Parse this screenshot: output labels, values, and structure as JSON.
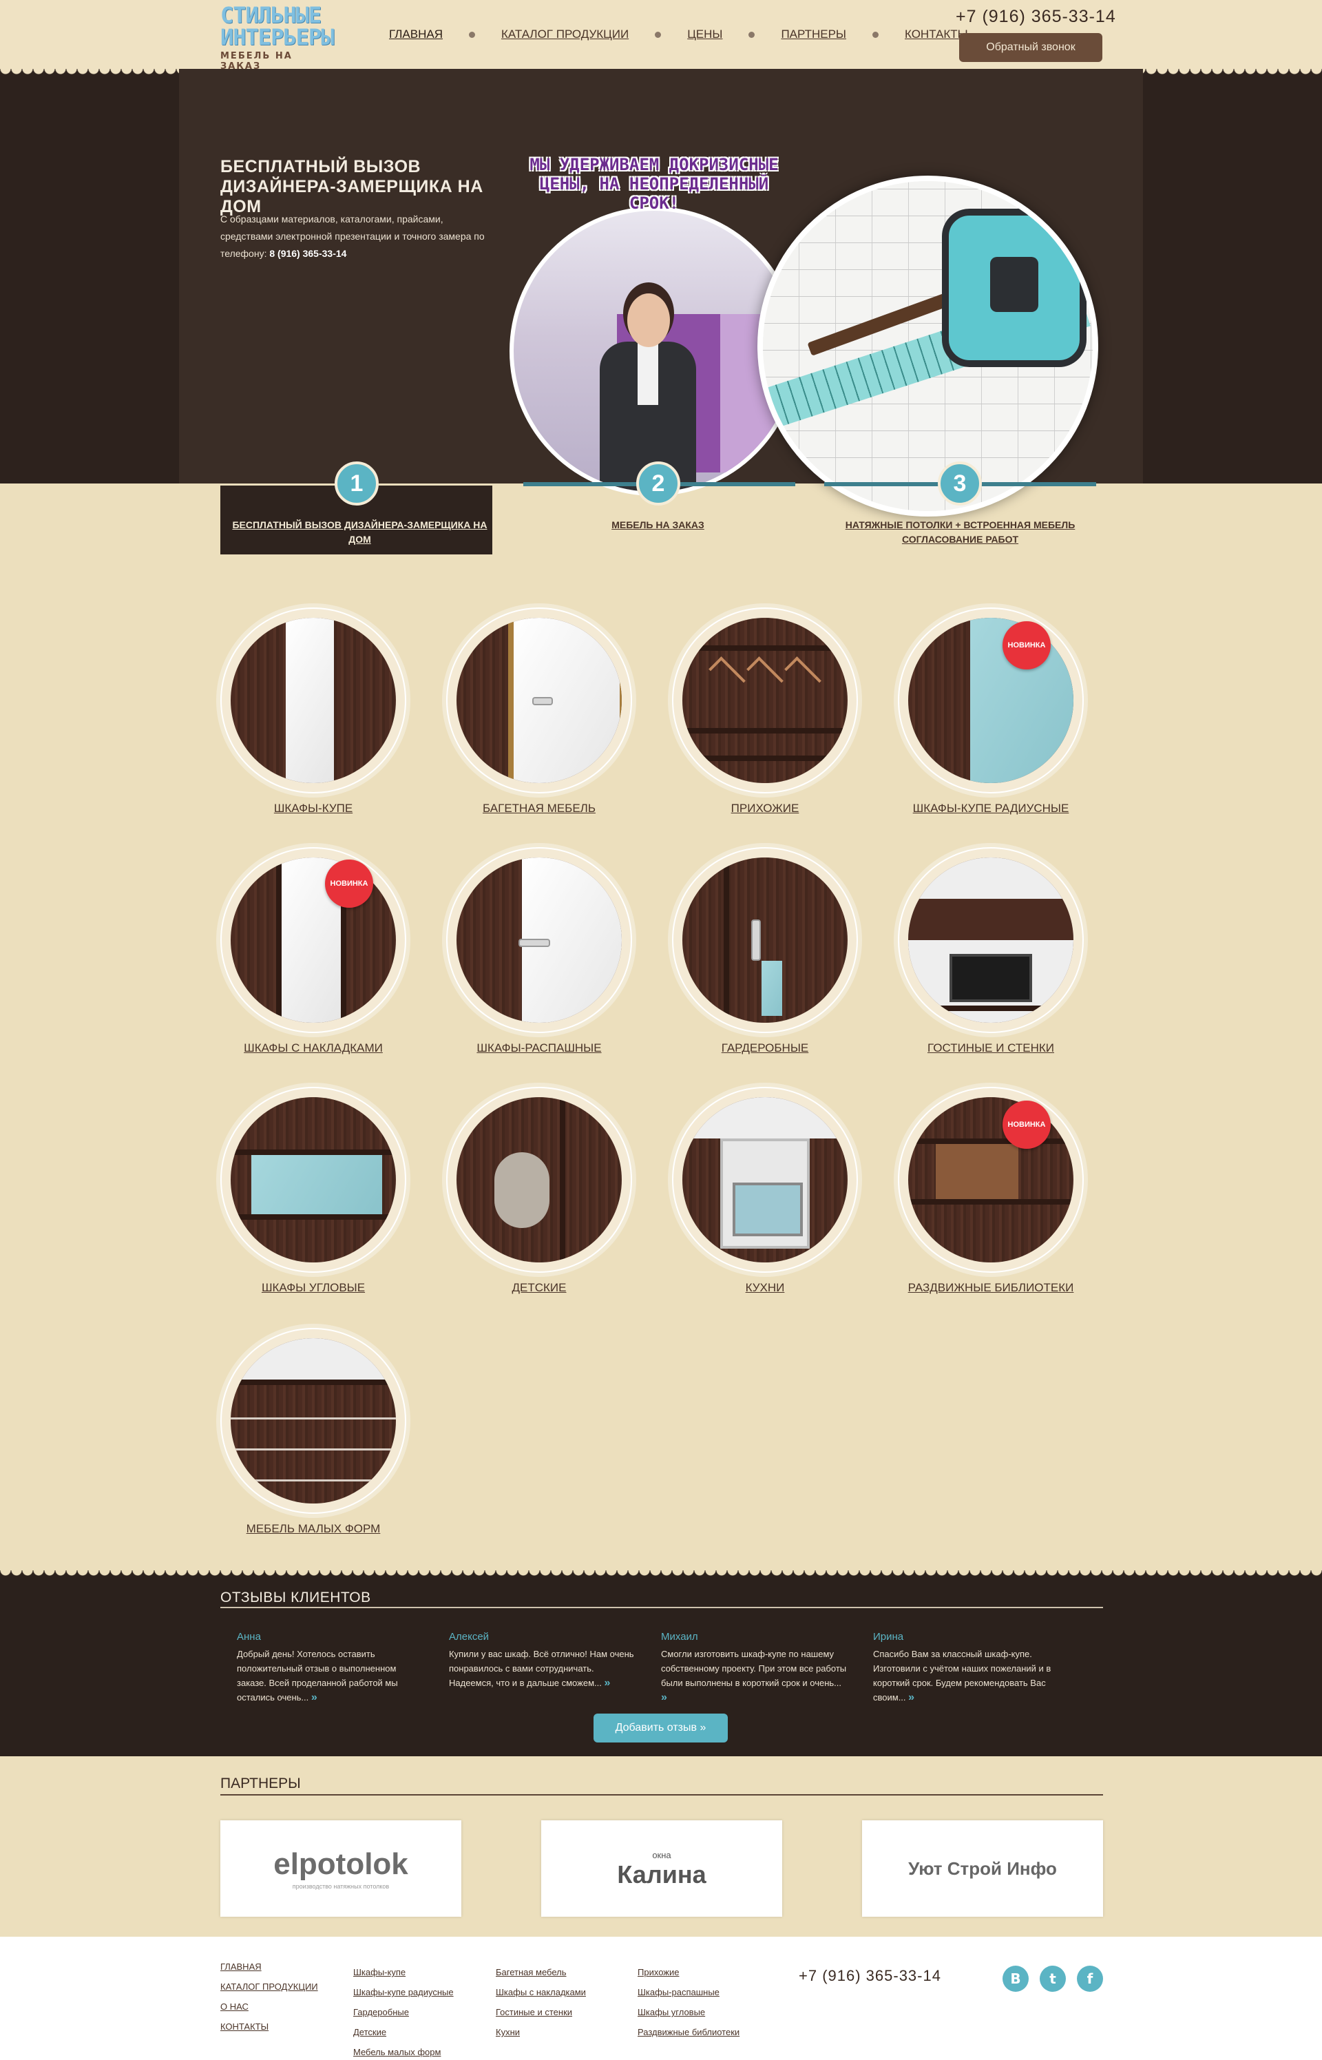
{
  "header": {
    "logo_line1": "СТИЛЬНЫЕ",
    "logo_line2": "ИНТЕРЬЕРЫ",
    "logo_line3": "МЕБЕЛЬ НА ЗАКАЗ",
    "nav": [
      "ГЛАВНАЯ",
      "КАТАЛОГ ПРОДУКЦИИ",
      "ЦЕНЫ",
      "ПАРТНЕРЫ",
      "КОНТАКТЫ"
    ],
    "phone": "+7 (916) 365-33-14",
    "callback_label": "Обратный звонок"
  },
  "hero": {
    "title": "БЕСПЛАТНЫЙ ВЫЗОВ ДИЗАЙНЕРА-ЗАМЕРЩИКА НА ДОМ",
    "text": "С образцами материалов, каталогами, прайсами, средствами электронной презентации и точного замера по телефону:",
    "text_phone": "8 (916) 365-33-14",
    "promo": "МЫ УДЕРЖИВАЕМ ДОКРИЗИСНЫЕ ЦЕНЫ, НА НЕОПРЕДЕЛЕННЫЙ СРОК!"
  },
  "steps": [
    {
      "num": "1",
      "label": "БЕСПЛАТНЫЙ ВЫЗОВ ДИЗАЙНЕРА-ЗАМЕРЩИКА НА ДОМ"
    },
    {
      "num": "2",
      "label": "МЕБЕЛЬ НА ЗАКАЗ"
    },
    {
      "num": "3",
      "label": "НАТЯЖНЫЕ ПОТОЛКИ + ВСТРОЕННАЯ МЕБЕЛЬ СОГЛАСОВАНИЕ РАБОТ"
    }
  ],
  "catalog": [
    {
      "label": "ШКАФЫ-КУПЕ"
    },
    {
      "label": "БАГЕТНАЯ МЕБЕЛЬ"
    },
    {
      "label": "ПРИХОЖИЕ"
    },
    {
      "label": "ШКАФЫ-КУПЕ РАДИУСНЫЕ",
      "badge": "НОВИНКА"
    },
    {
      "label": "ШКАФЫ С НАКЛАДКАМИ",
      "badge": "НОВИНКА"
    },
    {
      "label": "ШКАФЫ-РАСПАШНЫЕ"
    },
    {
      "label": "ГАРДЕРОБНЫЕ"
    },
    {
      "label": "ГОСТИНЫЕ И СТЕНКИ"
    },
    {
      "label": "ШКАФЫ УГЛОВЫЕ"
    },
    {
      "label": "ДЕТСКИЕ"
    },
    {
      "label": "КУХНИ"
    },
    {
      "label": "РАЗДВИЖНЫЕ БИБЛИОТЕКИ",
      "badge": "НОВИНКА"
    },
    {
      "label": "МЕБЕЛЬ МАЛЫХ ФОРМ"
    }
  ],
  "reviews": {
    "title": "ОТЗЫВЫ КЛИЕНТОВ",
    "items": [
      {
        "name": "Анна",
        "text": "Добрый день! Хотелось оставить положительный отзыв о выполненном заказе. Всей проделанной работой мы остались очень..."
      },
      {
        "name": "Алексей",
        "text": "Купили у вас шкаф. Всё отлично! Нам очень понравилось с вами сотрудничать. Надеемся, что и в дальше сможем..."
      },
      {
        "name": "Михаил",
        "text": "Смогли изготовить шкаф-купе по нашему собственному проекту. При этом все работы были выполнены в короткий срок и очень..."
      },
      {
        "name": "Ирина",
        "text": "Спасибо Вам за классный шкаф-купе. Изготовили с учётом наших пожеланий и в короткий срок. Будем рекомендовать Вас своим..."
      }
    ],
    "more_glyph": "»",
    "add_label": "Добавить отзыв »"
  },
  "partners": {
    "title": "ПАРТНЕРЫ",
    "items": [
      {
        "name": "elpotolok",
        "sub": "производство натяжных потолков"
      },
      {
        "name": "Калина",
        "sub": "окна"
      },
      {
        "name": "Уют Строй Инфо",
        "sub": ""
      }
    ]
  },
  "footer": {
    "col1": [
      "ГЛАВНАЯ",
      "КАТАЛОГ ПРОДУКЦИИ",
      "О НАС",
      "КОНТАКТЫ"
    ],
    "col2": [
      "Шкафы-купе",
      "Шкафы-купе радиусные",
      "Гардеробные",
      "Детские",
      "Мебель малых форм"
    ],
    "col3": [
      "Багетная мебель",
      "Шкафы с накладками",
      "Гостиные и стенки",
      "Кухни"
    ],
    "col4": [
      "Прихожие",
      "Шкафы-распашные",
      "Шкафы угловые",
      "Раздвижные библиотеки"
    ],
    "phone": "+7 (916) 365-33-14",
    "social": [
      "В",
      "t",
      "f"
    ]
  },
  "colors": {
    "background": "#ecdfbd",
    "dark": "#2b211c",
    "accent": "#5bb4c4",
    "button": "#6a4c39",
    "badge": "#e8323a"
  }
}
